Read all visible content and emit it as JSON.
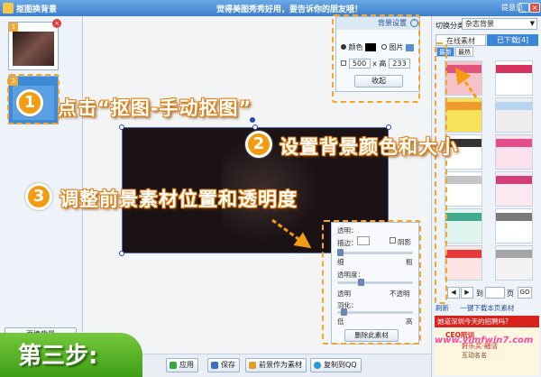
{
  "titlebar": {
    "app_title": "抠图换背景",
    "slogan": "觉得美图秀秀好用，要告诉你的朋友哦！",
    "help": "提意见",
    "minimize": "_",
    "maximize": "□",
    "close": "×"
  },
  "left": {
    "thumbs": [
      {
        "num": "1",
        "delete": "×"
      },
      {
        "num": "2"
      }
    ],
    "change_bg_label": "更换背景"
  },
  "bg_settings": {
    "header": "背景设置",
    "color_label": "颜色",
    "image_label": "图片",
    "width_value": "500",
    "x_label": "x",
    "height_label": "高",
    "height_value": "233",
    "collapse_label": "收起",
    "color_swatch": "#000000"
  },
  "fg_panel": {
    "title": "透明：",
    "edge_label": "描边：",
    "shadow_label": "阴影",
    "thin_label": "细",
    "thick_label": "粗",
    "opacity_label": "透明度：",
    "transparent_label": "透明",
    "opaque_label": "不透明",
    "feather_label": "羽化：",
    "low_label": "低",
    "high_label": "高",
    "delete_label": "删除此素材",
    "opacity_level": 0.3,
    "feather_level": 0.05,
    "edge_level": 0.0
  },
  "right": {
    "switch_label": "切换分类",
    "category_value": "杂志背景",
    "tab_online": "在线素材",
    "tab_downloaded": "已下载[4]",
    "subtab_newest": "最新",
    "subtab_hottest": "最热",
    "page_label": "到",
    "page_unit": "页",
    "go": "GO",
    "refresh": "刷新",
    "download_all": "一键下载本页素材",
    "ad_line": "她道深圳今天的招聘吗?",
    "ad_title": "CEO陪训",
    "ad_sub1": "好乐买·融活",
    "ad_sub2": "互动名名"
  },
  "bottombar": {
    "apply": "应用",
    "save": "保存",
    "save_as_material": "前景作为素材",
    "copy_to_qq": "复制到QQ"
  },
  "tutorial": {
    "step1_num": "1",
    "step1_text": "点击“抠图-手动抠图”",
    "step2_num": "2",
    "step2_text": "设置背景颜色和大小",
    "step3_num": "3",
    "step3_text": "调整前景素材位置和透明度",
    "step_banner": "第三步:"
  },
  "watermark": "www.ylmfwin7.com",
  "colors": {
    "accent_orange": "#f39c12",
    "titlebar_blue": "#3d7fcc",
    "banner_green": "#4aa61c"
  }
}
